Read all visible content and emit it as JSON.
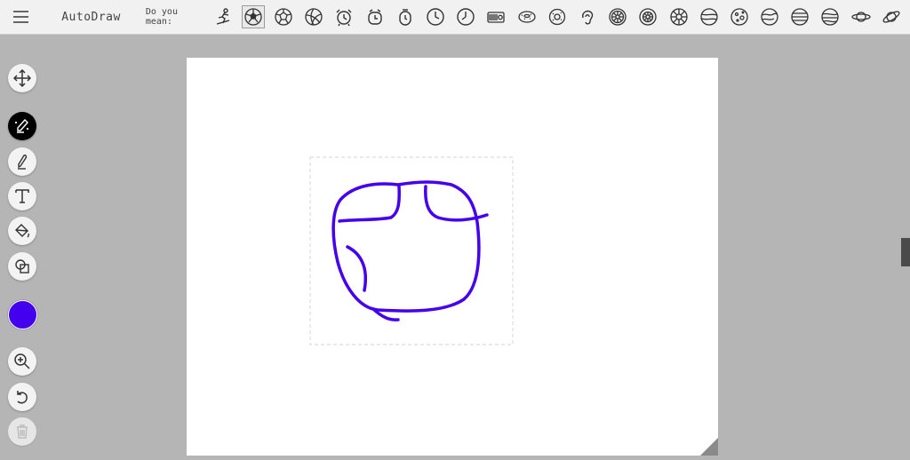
{
  "app": {
    "title": "AutoDraw"
  },
  "header": {
    "prompt_label": "Do you mean:",
    "suggestions": [
      "skier-icon",
      "soccer-ball-icon",
      "soccer-ball-icon",
      "volleyball-icon",
      "alarm-clock-icon",
      "alarm-clock-icon",
      "alarm-clock-icon",
      "clock-icon",
      "clock-icon",
      "radio-icon",
      "donut-icon",
      "donut-icon",
      "ear-icon",
      "wheel-icon",
      "wheel-icon",
      "wheel-icon",
      "planet-icon",
      "planet-icon",
      "planet-icon",
      "planet-icon",
      "planet-icon",
      "saturn-icon",
      "saturn-icon"
    ],
    "selected_index": 1
  },
  "tools": [
    {
      "name": "move-tool",
      "icon": "move-icon"
    },
    {
      "name": "autodraw-tool",
      "icon": "autodraw-pen-icon",
      "active": true
    },
    {
      "name": "draw-tool",
      "icon": "pencil-icon"
    },
    {
      "name": "type-tool",
      "icon": "text-icon"
    },
    {
      "name": "fill-tool",
      "icon": "paint-bucket-icon"
    },
    {
      "name": "shape-tool",
      "icon": "shapes-icon"
    },
    {
      "name": "zoom-tool",
      "icon": "zoom-in-icon"
    },
    {
      "name": "undo-tool",
      "icon": "undo-icon"
    },
    {
      "name": "delete-tool",
      "icon": "trash-icon",
      "disabled": true
    }
  ],
  "colors": {
    "current_stroke": "#4400ee",
    "background": "#b5b5b5",
    "toolbar": "#f1f1f1"
  }
}
